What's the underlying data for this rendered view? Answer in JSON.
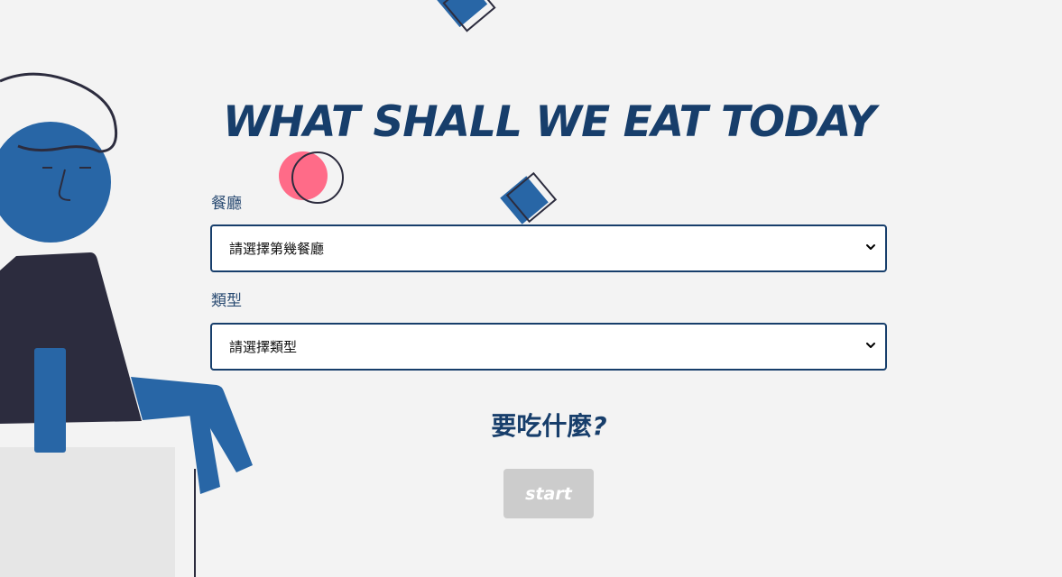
{
  "page": {
    "title": "WHAT SHALL WE EAT TODAY"
  },
  "form": {
    "restaurant": {
      "label": "餐廳",
      "selected": "請選擇第幾餐廳"
    },
    "type": {
      "label": "類型",
      "selected": "請選擇類型"
    }
  },
  "question": {
    "text": "要吃什麼",
    "mark": "?"
  },
  "start_button": {
    "label": "start"
  },
  "colors": {
    "background": "#f3f3f3",
    "accent_blue": "#2866a6",
    "navy": "#173e6b",
    "dark": "#2c2c3e",
    "pink": "#ff6b88",
    "button_disabled": "#cccccc"
  },
  "icons": [
    "chevron-down-icon",
    "chevron-down-icon"
  ]
}
